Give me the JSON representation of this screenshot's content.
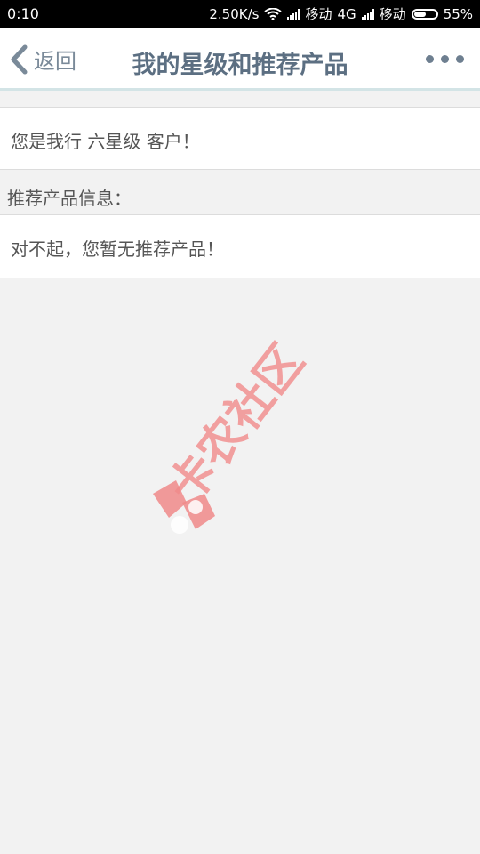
{
  "status_bar": {
    "time": "0:10",
    "speed": "2.50K/s",
    "carrier1": "移动",
    "network": "4G",
    "carrier2": "移动",
    "battery_percent": "55%",
    "battery_level": 0.55
  },
  "header": {
    "back_label": "返回",
    "title": "我的星级和推荐产品"
  },
  "star_panel": {
    "text": "您是我行 六星级 客户！"
  },
  "recommend": {
    "label": "推荐产品信息：",
    "message": "对不起，您暂无推荐产品！"
  },
  "watermark": {
    "text": "卡农社区",
    "color": "#f08a8a"
  }
}
